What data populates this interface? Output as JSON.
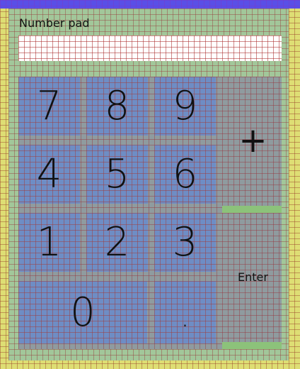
{
  "title": "Number pad",
  "display": {
    "value": ""
  },
  "keys": {
    "k7": "7",
    "k8": "8",
    "k9": "9",
    "k4": "4",
    "k5": "5",
    "k6": "6",
    "k1": "1",
    "k2": "2",
    "k3": "3",
    "k0": "0",
    "dot": ".",
    "plus": "+",
    "enter": "Enter"
  },
  "colors": {
    "background": "#dede74",
    "title_bar": "#5a4fe6",
    "panel": "#a2c79a",
    "keypad": "#8f9b9f",
    "number_key": "#6e8dc5",
    "display": "#ffffff",
    "accent_bar": "#8cc27a"
  }
}
